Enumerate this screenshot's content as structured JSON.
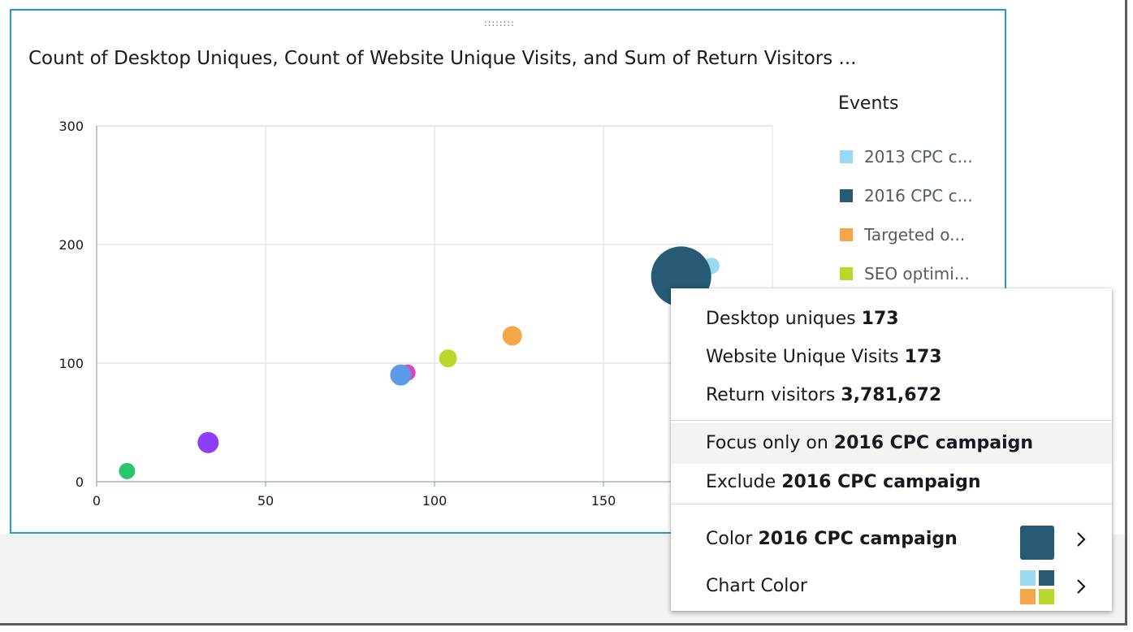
{
  "visual": {
    "title": "Count of Desktop Uniques, Count of Website Unique Visits, and Sum of Return Visitors ...",
    "drag_handle": "::::::::"
  },
  "legend": {
    "title": "Events",
    "items": [
      {
        "label": "2013 CPC c...",
        "color": "#9ad9f2"
      },
      {
        "label": "2016 CPC c...",
        "color": "#265a75"
      },
      {
        "label": "Targeted o...",
        "color": "#f6a54b"
      },
      {
        "label": "SEO optimi...",
        "color": "#b8d92c"
      }
    ]
  },
  "chart_data": {
    "type": "scatter",
    "title": "Count of Desktop Uniques, Count of Website Unique Visits, and Sum of Return Visitors ...",
    "xlabel": "",
    "ylabel": "",
    "xlim": [
      0,
      200
    ],
    "ylim": [
      0,
      300
    ],
    "x_ticks": [
      0,
      50,
      100,
      150
    ],
    "y_ticks": [
      0,
      100,
      200,
      300
    ],
    "grid": true,
    "legend_title": "Events",
    "legend_position": "right",
    "points": [
      {
        "x": 9,
        "y": 9,
        "size": 10,
        "color": "#2bc46f"
      },
      {
        "x": 33,
        "y": 33,
        "size": 13,
        "color": "#8b3dfb"
      },
      {
        "x": 92,
        "y": 92,
        "size": 10,
        "color": "#e043c1"
      },
      {
        "x": 90,
        "y": 90,
        "size": 13,
        "color": "#5a9ae6"
      },
      {
        "x": 104,
        "y": 104,
        "size": 11,
        "color": "#b8d92c"
      },
      {
        "x": 123,
        "y": 123,
        "size": 12,
        "color": "#f6a54b"
      },
      {
        "x": 182,
        "y": 182,
        "size": 10,
        "color": "#9ad9f2"
      },
      {
        "x": 173,
        "y": 173,
        "size": 37,
        "color": "#265a75"
      }
    ]
  },
  "context_menu": {
    "info": [
      {
        "label": "Desktop uniques",
        "value": "173"
      },
      {
        "label": "Website Unique Visits",
        "value": "173"
      },
      {
        "label": "Return visitors",
        "value": "3,781,672"
      }
    ],
    "focus": {
      "prefix": "Focus only on",
      "target": "2016 CPC campaign"
    },
    "exclude": {
      "prefix": "Exclude",
      "target": "2016 CPC campaign"
    },
    "color": {
      "prefix": "Color",
      "target": "2016 CPC campaign",
      "swatch": "#265a75"
    },
    "chart_color": {
      "label": "Chart Color",
      "palette": [
        "#9ad9f2",
        "#265a75",
        "#f6a54b",
        "#b8d92c"
      ]
    },
    "chevron_icon": "chevron-right-icon"
  }
}
